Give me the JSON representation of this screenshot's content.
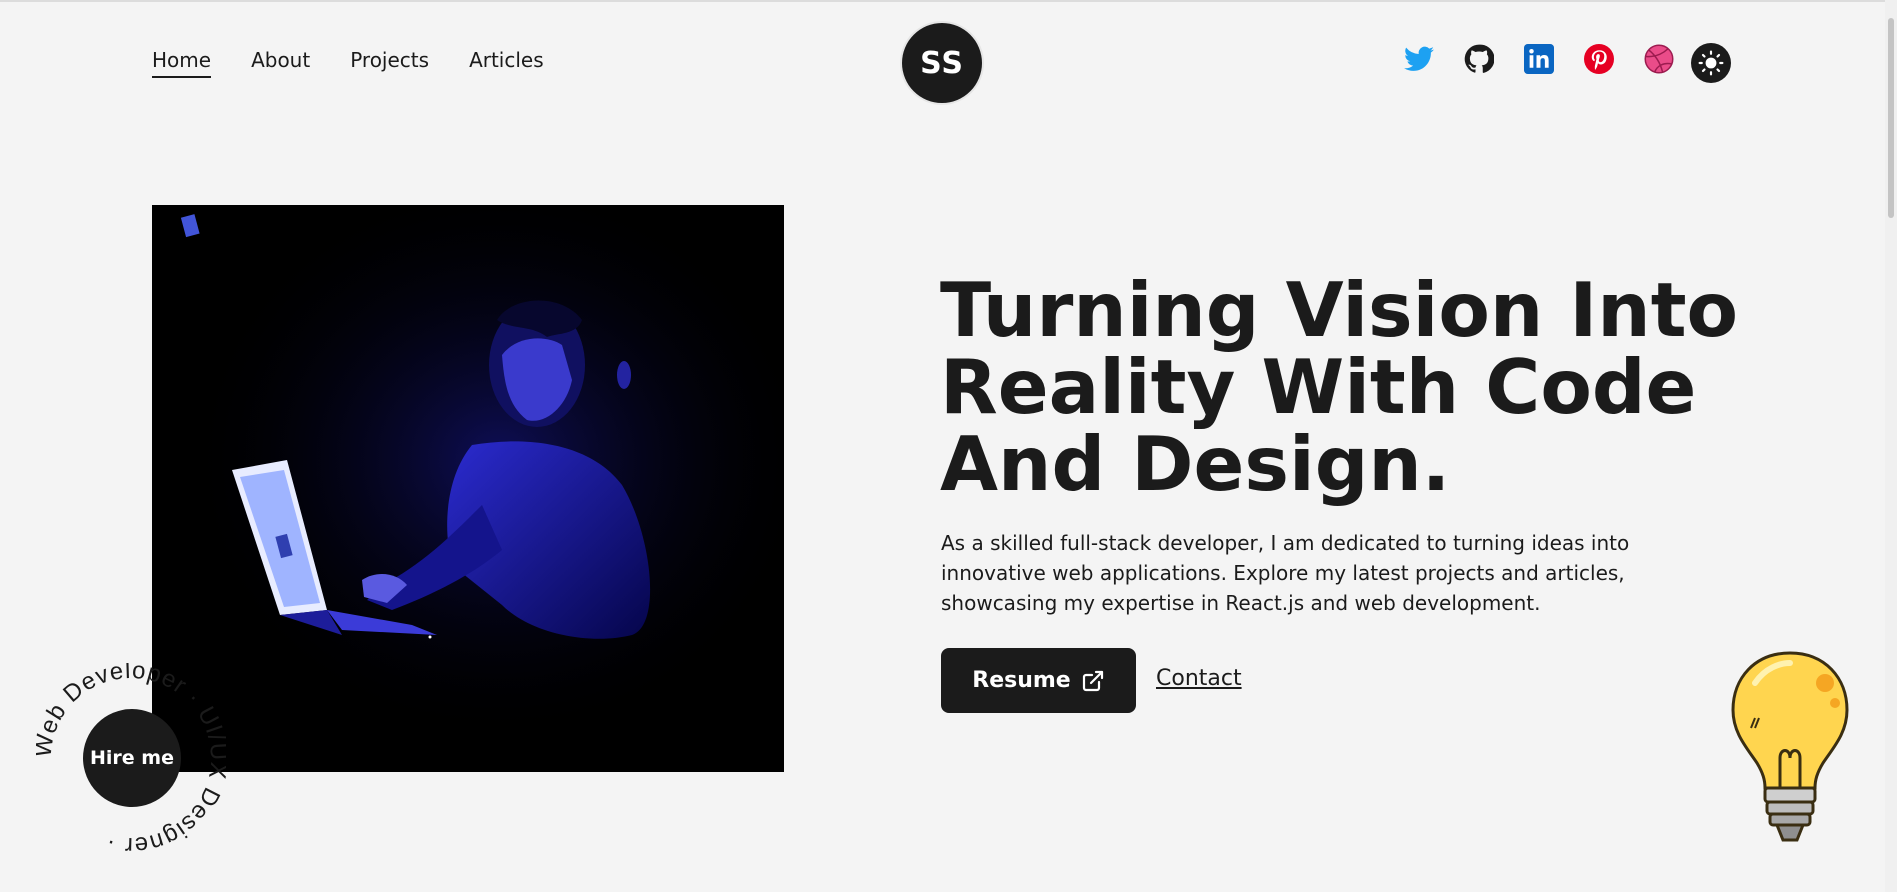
{
  "nav": {
    "items": [
      {
        "label": "Home",
        "active": true
      },
      {
        "label": "About"
      },
      {
        "label": "Projects"
      },
      {
        "label": "Articles"
      }
    ]
  },
  "logo": {
    "initials": "SS"
  },
  "social": {
    "icons": [
      "twitter-icon",
      "github-icon",
      "linkedin-icon",
      "pinterest-icon",
      "dribbble-icon"
    ],
    "colors": {
      "twitter": "#1DA1F2",
      "github": "#1b1b1b",
      "linkedin": "#0A66C2",
      "pinterest": "#E60023",
      "dribbble": "#EA4C89"
    }
  },
  "theme_toggle": {
    "icon": "sun-icon"
  },
  "hero": {
    "headline_lines": [
      "Turning Vision Into",
      "Reality With Code",
      "And Design."
    ],
    "description": "As a skilled full-stack developer, I am dedicated to turning ideas into innovative web applications. Explore my latest projects and articles, showcasing my expertise in React.js and web development.",
    "resume_label": "Resume",
    "resume_icon": "external-link-icon",
    "contact_label": "Contact"
  },
  "hire": {
    "label": "Hire me",
    "ring_text": "Web Developer · UI/UX Designer · "
  },
  "colors": {
    "background": "#f4f4f4",
    "dark": "#1b1b1b",
    "accent_bulb": "#FFD54F"
  }
}
